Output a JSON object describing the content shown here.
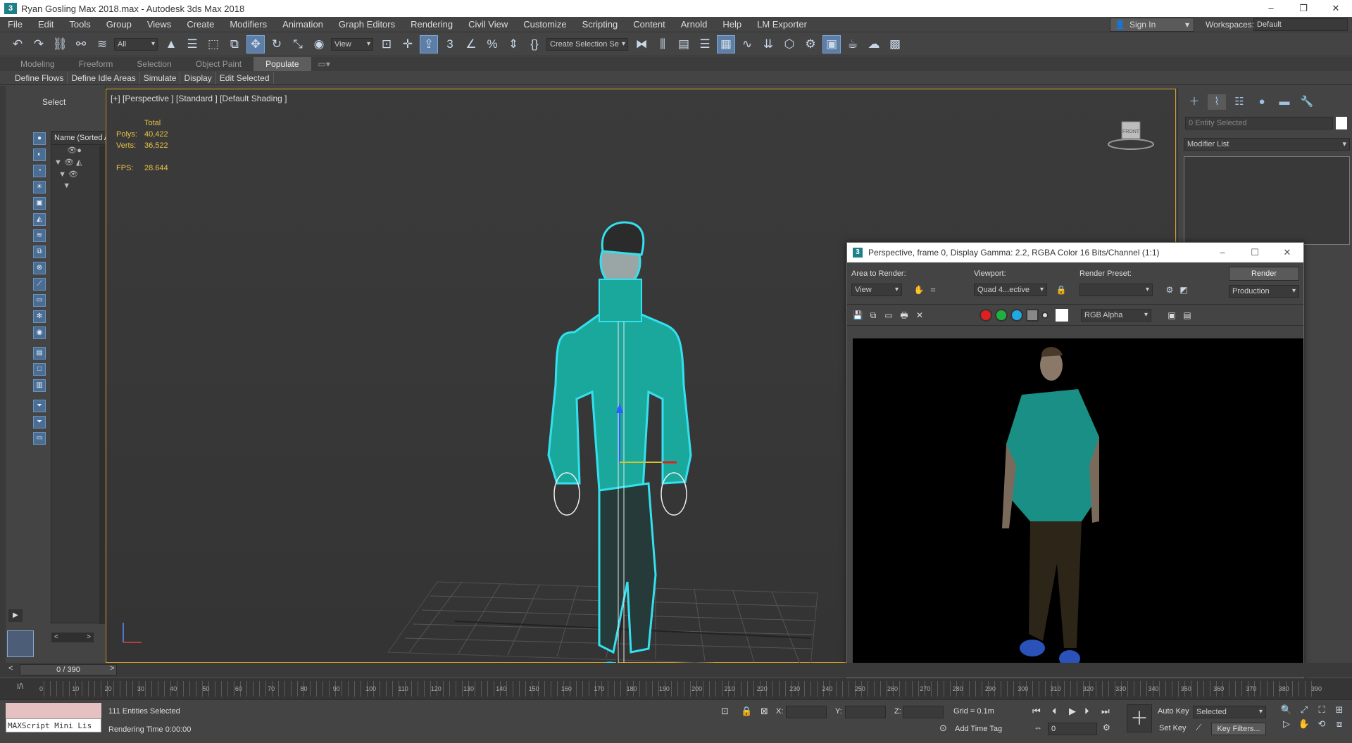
{
  "window": {
    "title": "Ryan Gosling Max 2018.max - Autodesk 3ds Max 2018",
    "app_icon": "3",
    "controls": [
      "–",
      "❐",
      "✕"
    ]
  },
  "menu": {
    "items": [
      "File",
      "Edit",
      "Tools",
      "Group",
      "Views",
      "Create",
      "Modifiers",
      "Animation",
      "Graph Editors",
      "Rendering",
      "Civil View",
      "Customize",
      "Scripting",
      "Content",
      "Arnold",
      "Help",
      "LM Exporter"
    ],
    "sign_in": "Sign In",
    "workspaces_label": "Workspaces:",
    "workspace": "Default"
  },
  "toolbar": {
    "selection_filter": "All",
    "ref_coord": "View",
    "named_selection": "Create Selection Se"
  },
  "ribbon": {
    "tabs": [
      "Modeling",
      "Freeform",
      "Selection",
      "Object Paint",
      "Populate"
    ],
    "active_tab": "Populate",
    "sub_items": [
      "Define Flows",
      "Define Idle Areas",
      "Simulate",
      "Display",
      "Edit Selected"
    ]
  },
  "explorer": {
    "header": "Select",
    "column_header": "Name (Sorted A",
    "scroll_left": "<",
    "scroll_right": ">",
    "play": "▶"
  },
  "viewport": {
    "label": "[+] [Perspective ] [Standard ] [Default Shading ]",
    "stats": {
      "total_label": "Total",
      "polys_label": "Polys:",
      "polys": "40,422",
      "verts_label": "Verts:",
      "verts": "36,522",
      "fps_label": "FPS:",
      "fps": "28.644"
    },
    "viewcube_text": "FRONT"
  },
  "command_panel": {
    "entity_field": "0 Entity Selected",
    "modifier_list": "Modifier List"
  },
  "render_window": {
    "title": "Perspective, frame 0, Display Gamma: 2.2, RGBA Color 16 Bits/Channel (1:1)",
    "icon": "3",
    "controls": [
      "–",
      "☐",
      "✕"
    ],
    "area_label": "Area to Render:",
    "area_value": "View",
    "viewport_label": "Viewport:",
    "viewport_value": "Quad 4...ective",
    "preset_label": "Render Preset:",
    "preset_value": "",
    "render_button": "Render",
    "production": "Production",
    "channel": "RGB Alpha",
    "channel_colors": [
      "#e02020",
      "#20b040",
      "#20a8e0",
      "#888888",
      "#dddddd"
    ]
  },
  "timeline": {
    "time_slider": "0 / 390",
    "prev": "<",
    "next": ">",
    "tick_labels": [
      "0",
      "10",
      "20",
      "30",
      "40",
      "50",
      "60",
      "70",
      "80",
      "90",
      "100",
      "110",
      "120",
      "130",
      "140",
      "150",
      "160",
      "170",
      "180",
      "190",
      "200",
      "210",
      "220",
      "230",
      "240",
      "250",
      "260",
      "270",
      "280",
      "290",
      "300",
      "310",
      "320",
      "330",
      "340",
      "350",
      "360",
      "370",
      "380",
      "390"
    ]
  },
  "status": {
    "maxscript": "MAXScript Mini Lis",
    "selected": "111 Entities Selected",
    "rendering_time": "Rendering Time 0:00:00",
    "x_label": "X:",
    "y_label": "Y:",
    "z_label": "Z:",
    "grid": "Grid = 0.1m",
    "add_time_tag": "Add Time Tag",
    "auto_key": "Auto Key",
    "set_key": "Set Key",
    "selected_drop": "Selected",
    "key_filters": "Key Filters...",
    "frame": "0"
  },
  "colors": {
    "shirt": "#1aa89c",
    "selection_outline": "#35e0ee",
    "stats_yellow": "#e8c244",
    "viewport_border": "#d8a22b"
  }
}
